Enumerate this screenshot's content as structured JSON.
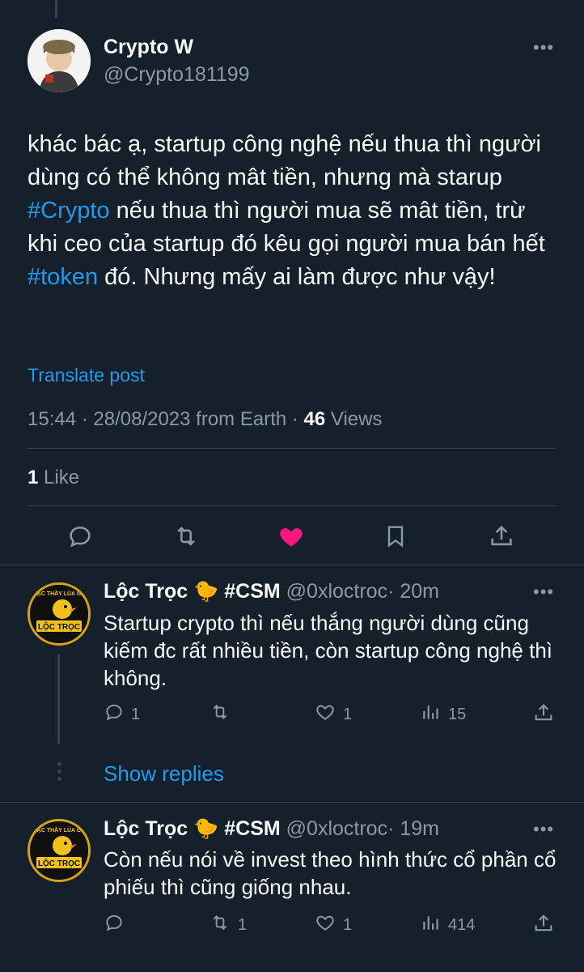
{
  "tweet": {
    "author_name": "Crypto W",
    "author_handle": "@Crypto181199",
    "text_parts": [
      "khác bác ạ, startup công nghệ nếu thua thì người dùng có thể không mât tiền, nhưng mà starup ",
      "#Crypto",
      "  nếu thua thì người mua sẽ mât tiền, trừ khi ceo của startup đó kêu gọi người mua bán hết ",
      "#token",
      " đó. Nhưng mấy ai làm được như vậy!"
    ],
    "translate_label": "Translate post",
    "timestamp": "15:44 · 28/08/2023 from Earth · ",
    "views_count": "46",
    "views_label": " Views",
    "likes_count": "1",
    "likes_label": " Like",
    "liked": true,
    "like_color": "#f91880"
  },
  "replies": [
    {
      "name": "Lộc Trọc",
      "badge_emoji": "🐤",
      "tag": "#CSM",
      "handle": "@0xloctroc",
      "time": "· 20m",
      "text": "Startup crypto thì nếu thắng người dùng cũng kiếm đc rất nhiều tiền, còn startup công nghệ thì không.",
      "reply_count": "1",
      "retweet_count": "",
      "like_count": "1",
      "view_count": "15",
      "avatar_top_text": "BẬC THẦY LÙA GÀ",
      "avatar_main_text": "LỘC TRỌC"
    },
    {
      "name": "Lộc Trọc",
      "badge_emoji": "🐤",
      "tag": "#CSM",
      "handle": "@0xloctroc",
      "time": "· 19m",
      "text": "Còn nếu nói về invest theo hình thức cổ phần cổ phiếu thì cũng giống nhau.",
      "reply_count": "",
      "retweet_count": "1",
      "like_count": "1",
      "view_count": "414",
      "avatar_top_text": "BẬC THẦY LÙA GÀ",
      "avatar_main_text": "LỘC TRỌC"
    }
  ],
  "show_replies_label": "Show replies",
  "colors": {
    "background": "#15202b",
    "accent": "#1d9bf0",
    "muted": "#8b98a5",
    "divider": "#38444d"
  }
}
